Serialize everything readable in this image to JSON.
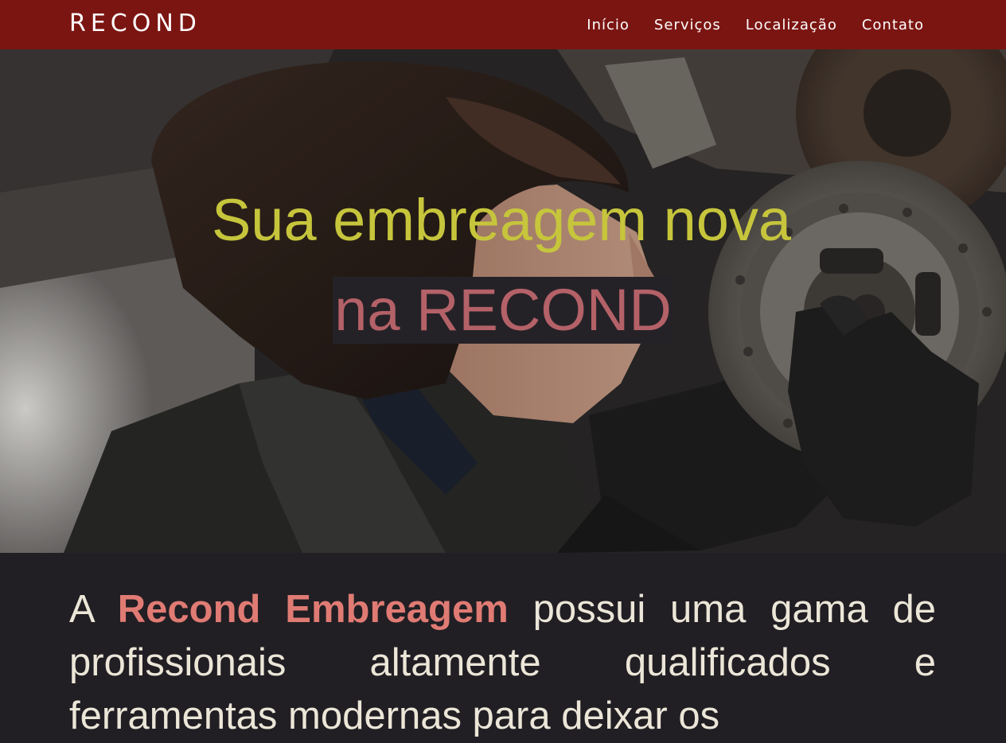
{
  "navbar": {
    "brand": "RECOND",
    "links": [
      {
        "label": "Início"
      },
      {
        "label": "Serviços"
      },
      {
        "label": "Localização"
      },
      {
        "label": "Contato"
      }
    ],
    "background": "#7b1512"
  },
  "hero": {
    "line1": "Sua embreagem nova",
    "line2": "na RECOND",
    "line1_color": "#c6c53c",
    "line2_color": "#b46168"
  },
  "about": {
    "prefix": "A ",
    "highlight": "Recond Embreagem",
    "rest": " possui uma gama de profissionais altamente qualificados e ferramentas modernas para deixar os",
    "highlight_color": "#e07b74"
  }
}
